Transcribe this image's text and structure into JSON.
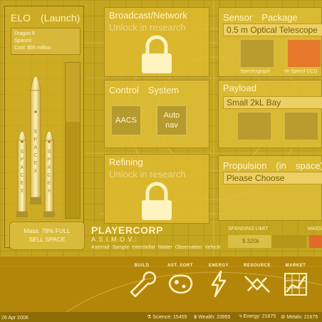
{
  "launch": {
    "title": "ELO　(Launch)",
    "rocket": "Dragon 9",
    "company": "SpaceX",
    "cost": "Cost: $55 million",
    "booster_letters": "SPACEX",
    "mass_line1": "Mass:  78% FULL",
    "mass_line2": "SELL SPACE",
    "fill_fraction": 0.62
  },
  "broadcast": {
    "title": "Broadcast/Network",
    "status": "Unlock in research"
  },
  "sensor": {
    "title": "Sensor　Package",
    "selected": "0.5 m Optical Telescope",
    "items": [
      "Spectrograph",
      "Hi-Speed CCD"
    ]
  },
  "control": {
    "title": "Control　System",
    "buttons": [
      "AACS",
      "Auto nav"
    ]
  },
  "payload": {
    "title": "Payload",
    "selected": "Small 2kL Bay"
  },
  "refining": {
    "title": "Refining",
    "status": "Unlock in research"
  },
  "propulsion": {
    "title": "Propulsion　(in　space)",
    "selected": "Please Choose"
  },
  "corp": {
    "name": "PLAYERCORP",
    "vehicle": "A.S.I.M.O.V.:",
    "description": "Asteroid Sample Interstellar Matter Observation Vehicle"
  },
  "spending": {
    "label": "SPENDING LIMIT",
    "value": "$ 320k",
    "fraction": 0.55
  },
  "mass_header": "MASS",
  "toolbar": [
    "BUILD",
    "AST. SORT",
    "ENERGY",
    "RESOURCE",
    "MARKET"
  ],
  "status": {
    "date": "26 Apr 2006",
    "science": "Science: 15455",
    "wealth": "Wealth: 23955",
    "energy": "Energy: 21675",
    "metals": "Metals: 21675"
  },
  "icons": [
    "lock-icon",
    "wrench-icon",
    "asteroid-icon",
    "lightning-icon",
    "satellite-icon",
    "chart-icon",
    "flask-icon",
    "coin-icon",
    "bolt-icon",
    "gear-icon"
  ],
  "colors": {
    "background": "#c4a51f",
    "bottom_bar": "#b3860a",
    "accent_red": "#e06a2a"
  }
}
